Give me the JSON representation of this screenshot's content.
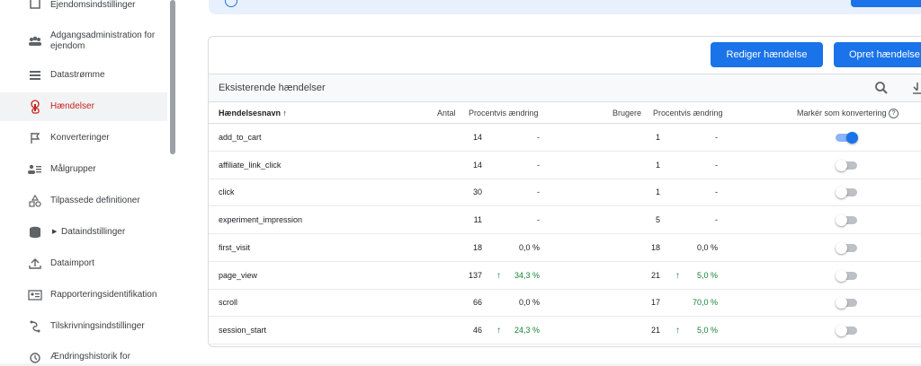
{
  "sidebar": {
    "items": [
      {
        "label": "Ejendomsindstillinger",
        "icon": "property-settings-icon"
      },
      {
        "label": "Adgangsadministration for ejendom",
        "icon": "people-icon"
      },
      {
        "label": "Datastrømme",
        "icon": "streams-icon"
      },
      {
        "label": "Hændelser",
        "icon": "touch-icon"
      },
      {
        "label": "Konverteringer",
        "icon": "flag-icon"
      },
      {
        "label": "Målgrupper",
        "icon": "audience-icon"
      },
      {
        "label": "Tilpassede definitioner",
        "icon": "shapes-icon"
      },
      {
        "label": "Dataindstillinger",
        "icon": "database-icon"
      },
      {
        "label": "Dataimport",
        "icon": "upload-icon"
      },
      {
        "label": "Rapporteringsidentifikation",
        "icon": "id-card-icon"
      },
      {
        "label": "Tilskrivningsindstillinger",
        "icon": "route-icon"
      },
      {
        "label": "Ændringshistorik for",
        "icon": "history-icon"
      }
    ],
    "active_label_color": "#c5221f"
  },
  "buttons": {
    "edit": "Rediger hændelse",
    "create": "Opret hændelse"
  },
  "table": {
    "title": "Eksisterende hændelser",
    "headers": {
      "name": "Hændelsesnavn",
      "count": "Antal",
      "count_change": "Procentvis ændring",
      "users": "Brugere",
      "users_change": "Procentvis ændring",
      "conversion": "Markér som konvertering"
    },
    "rows": [
      {
        "name": "add_to_cart",
        "count": "14",
        "count_change": "-",
        "users": "1",
        "users_change": "-",
        "conversion": true
      },
      {
        "name": "affiliate_link_click",
        "count": "14",
        "count_change": "-",
        "users": "1",
        "users_change": "-",
        "conversion": false
      },
      {
        "name": "click",
        "count": "30",
        "count_change": "-",
        "users": "1",
        "users_change": "-",
        "conversion": false
      },
      {
        "name": "experiment_impression",
        "count": "11",
        "count_change": "-",
        "users": "5",
        "users_change": "-",
        "conversion": false
      },
      {
        "name": "first_visit",
        "count": "18",
        "count_change": "0,0 %",
        "users": "18",
        "users_change": "0,0 %",
        "conversion": false
      },
      {
        "name": "page_view",
        "count": "137",
        "count_change": "34,3 %",
        "count_up": true,
        "users": "21",
        "users_change": "5,0 %",
        "users_up": true,
        "conversion": false
      },
      {
        "name": "scroll",
        "count": "66",
        "count_change": "0,0 %",
        "users": "17",
        "users_change": "70,0 %",
        "users_green": true,
        "conversion": false
      },
      {
        "name": "session_start",
        "count": "46",
        "count_change": "24,3 %",
        "count_up": true,
        "users": "21",
        "users_change": "5,0 %",
        "users_up": true,
        "conversion": false
      }
    ]
  },
  "colors": {
    "primary": "#1a73e8",
    "positive": "#188038"
  }
}
